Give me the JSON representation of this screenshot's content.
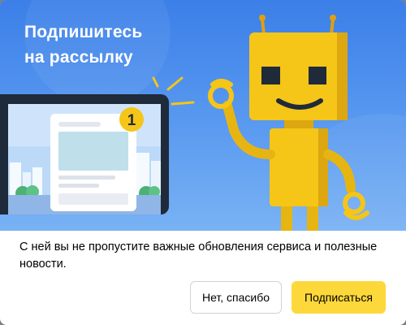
{
  "dialog": {
    "title": "Подпишитесь\nна рассылку",
    "badge_count": "1",
    "message": "С ней вы не пропустите важные обновления сервиса и полезные новости.",
    "decline_label": "Нет, спасибо",
    "subscribe_label": "Подписаться"
  },
  "colors": {
    "hero_background": "#4a8eec",
    "robot": "#f5c518",
    "badge": "#f5c518",
    "subscribe_button": "#fdd83b"
  }
}
